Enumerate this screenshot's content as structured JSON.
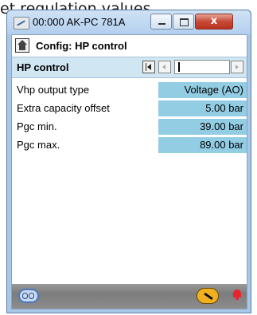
{
  "top_caption": "et regulation values",
  "window": {
    "title": "00:000 AK-PC 781A",
    "close_label": "x"
  },
  "config": {
    "title": "Config: HP control"
  },
  "section": {
    "title": "HP control"
  },
  "parameters": [
    {
      "label": "Vhp output type",
      "value": "Voltage (AO)"
    },
    {
      "label": "Extra capacity offset",
      "value": "5.00 bar"
    },
    {
      "label": "Pgc min.",
      "value": "39.00 bar"
    },
    {
      "label": "Pgc max.",
      "value": "89.00 bar"
    }
  ],
  "icons": {
    "app": "app-icon",
    "home": "home-icon",
    "first": "first-page-icon",
    "prev": "previous-icon",
    "next": "next-icon",
    "users": "users-icon",
    "service": "wrench-icon",
    "alarm": "alarm-bell-icon"
  },
  "colors": {
    "value_cell": "#93cde4",
    "section_band": "#d0e6f2",
    "close_button": "#c74a38",
    "alarm": "#e8242c"
  }
}
